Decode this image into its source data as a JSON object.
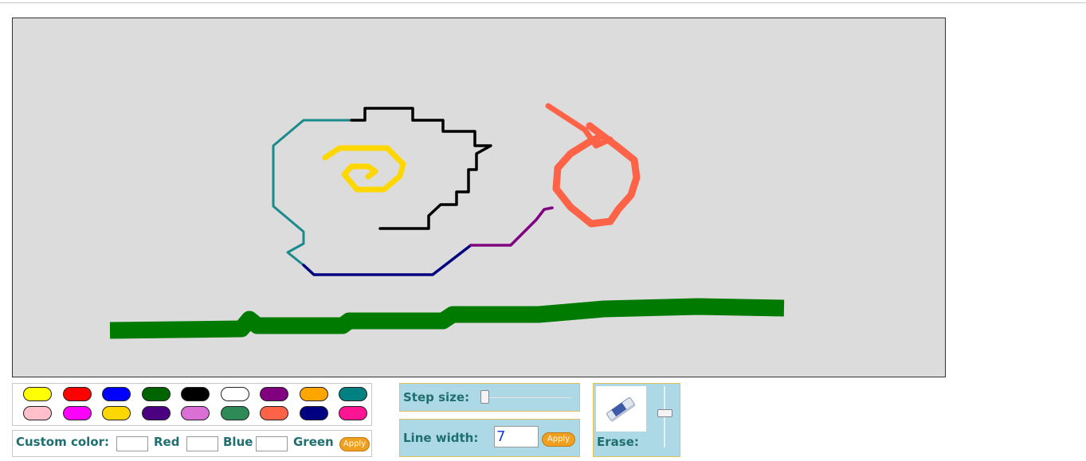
{
  "palette": {
    "row1": [
      "#ffff00",
      "#ff0000",
      "#0000ff",
      "#006400",
      "#000000",
      "#ffffff",
      "#800080",
      "#ffa500",
      "#008080"
    ],
    "row2": [
      "#ffc0cb",
      "#ff00ff",
      "#ffd700",
      "#4b0082",
      "#da70d6",
      "#2e8b57",
      "#ff6347",
      "#000080",
      "#ff1493"
    ]
  },
  "custom_color": {
    "label": "Custom color:",
    "red_label": "Red",
    "blue_label": "Blue",
    "green_label": "Green",
    "red_value": "",
    "blue_value": "",
    "green_value": "",
    "apply_label": "Apply"
  },
  "step_size": {
    "label": "Step size:"
  },
  "line_width": {
    "label": "Line width:",
    "value": "7",
    "apply_label": "Apply"
  },
  "erase": {
    "label": "Erase:",
    "icon": "eraser-icon"
  },
  "strokes_colors": {
    "teal": "#1a8a8a",
    "black": "#000000",
    "gold": "#ffd700",
    "navy": "#000080",
    "purple": "#800080",
    "tomato": "#ff6347",
    "green": "#007a00"
  }
}
